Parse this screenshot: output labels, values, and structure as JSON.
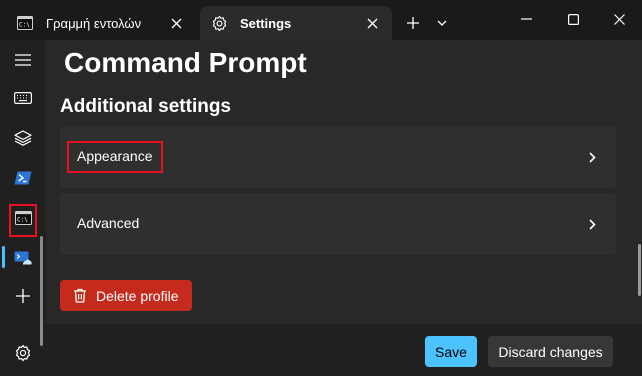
{
  "window": {
    "tabs": [
      {
        "label": "Γραμμή εντολών",
        "icon": "cmd-prompt-icon",
        "active": false
      },
      {
        "label": "Settings",
        "icon": "gear-icon",
        "active": true
      }
    ],
    "new_tab_icon": "plus-icon",
    "dropdown_icon": "chevron-down-icon",
    "controls": [
      "minimize-icon",
      "maximize-icon",
      "close-icon"
    ]
  },
  "sidebar": {
    "items": [
      {
        "name": "menu",
        "icon": "hamburger-menu-icon"
      },
      {
        "name": "interaction",
        "icon": "keyboard-icon"
      },
      {
        "name": "appearance",
        "icon": "layers-icon"
      },
      {
        "name": "powershell",
        "icon": "powershell-icon"
      },
      {
        "name": "command-prompt",
        "icon": "cmd-prompt-icon",
        "selected": true
      },
      {
        "name": "azure-cloud-shell",
        "icon": "azure-cloud-shell-icon"
      },
      {
        "name": "add-profile",
        "icon": "plus-icon"
      }
    ],
    "settings_icon": "gear-icon"
  },
  "main": {
    "page_title": "Command Prompt",
    "section_heading": "Additional settings",
    "cards": [
      {
        "label": "Appearance",
        "chevron": "chevron-right-icon"
      },
      {
        "label": "Advanced",
        "chevron": "chevron-right-icon"
      }
    ],
    "delete_button": {
      "label": "Delete profile",
      "icon": "trash-icon"
    }
  },
  "footer": {
    "save_label": "Save",
    "discard_label": "Discard changes"
  },
  "colors": {
    "accent": "#4cc2ff",
    "danger": "#c42b1c",
    "highlight": "#e81123",
    "background": "#202020",
    "card": "#2f2f2f"
  }
}
